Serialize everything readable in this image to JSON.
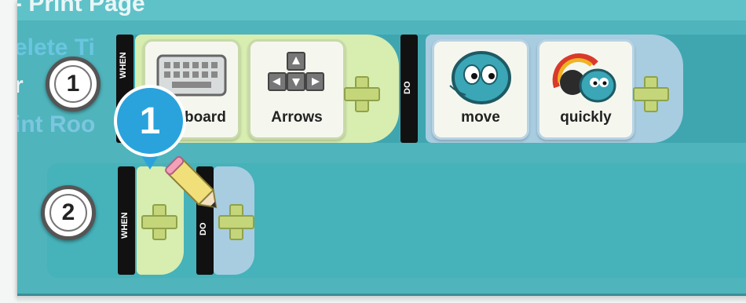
{
  "menu": {
    "line1": "‑ Print Page",
    "line2": "elete Ti",
    "line3": "r",
    "line4": "int Roo"
  },
  "rows": [
    {
      "number": "1",
      "when_label": "WHEN",
      "do_label": "DO",
      "when_tiles": [
        {
          "label": "Keyboard",
          "icon": "keyboard-icon"
        },
        {
          "label": "Arrows",
          "icon": "arrow-keys-icon"
        }
      ],
      "do_tiles": [
        {
          "label": "move",
          "icon": "kodu-face-icon"
        },
        {
          "label": "quickly",
          "icon": "speed-gauge-icon"
        }
      ]
    },
    {
      "number": "2",
      "when_label": "WHEN",
      "do_label": "DO"
    }
  ],
  "callout": {
    "number": "1"
  },
  "colors": {
    "background": "#4fb4bc",
    "when_area": "#d8edb0",
    "do_area": "#a8cde0",
    "badge": "#2aa3dc",
    "plus": "#c5d67a"
  }
}
